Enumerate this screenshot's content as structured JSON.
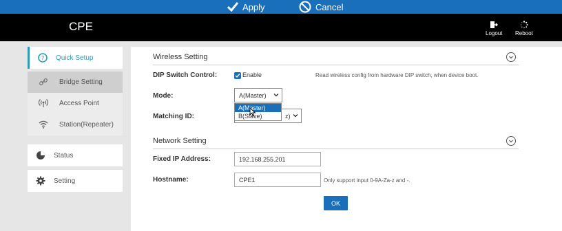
{
  "applybar": {
    "apply_label": "Apply",
    "cancel_label": "Cancel"
  },
  "header": {
    "title": "CPE",
    "logout_label": "Logout",
    "reboot_label": "Reboot"
  },
  "sidebar": {
    "quick_setup": "Quick Setup",
    "sub_items": [
      {
        "label": "Bridge Setting",
        "icon": "link-icon"
      },
      {
        "label": "Access Point",
        "icon": "access-point-icon"
      },
      {
        "label": "Station(Repeater)",
        "icon": "wifi-icon"
      }
    ],
    "status": "Status",
    "setting": "Setting"
  },
  "wireless": {
    "title": "Wireless Setting",
    "dip_label": "DIP Switch Control:",
    "dip_checked": true,
    "dip_option": "Enable",
    "dip_hint": "Read wireless config from hardware DIP switch, when device boot.",
    "mode_label": "Mode:",
    "mode_value": "A(Master)",
    "mode_options": [
      "A(Master)",
      "B(Slave)"
    ],
    "matching_label": "Matching ID:",
    "matching_value_tail": "z)"
  },
  "network": {
    "title": "Network Setting",
    "ip_label": "Fixed IP Address:",
    "ip_value": "192.168.255.201",
    "hostname_label": "Hostname:",
    "hostname_value": "CPE1",
    "hostname_hint": "Only support input 0-9A-Za-z and -."
  },
  "ok_label": "OK",
  "colors": {
    "accent": "#1a6fba",
    "active": "#2a9db5",
    "header": "#000000"
  }
}
